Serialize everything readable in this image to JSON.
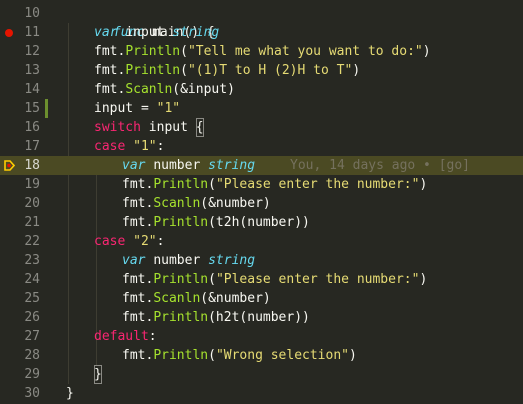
{
  "editor": {
    "lines": [
      {
        "num": "10"
      },
      {
        "num": "11"
      },
      {
        "num": "12"
      },
      {
        "num": "13"
      },
      {
        "num": "14"
      },
      {
        "num": "15"
      },
      {
        "num": "16"
      },
      {
        "num": "17"
      },
      {
        "num": "18"
      },
      {
        "num": "19"
      },
      {
        "num": "20"
      },
      {
        "num": "21"
      },
      {
        "num": "22"
      },
      {
        "num": "23"
      },
      {
        "num": "24"
      },
      {
        "num": "25"
      },
      {
        "num": "26"
      },
      {
        "num": "27"
      },
      {
        "num": "28"
      },
      {
        "num": "29"
      },
      {
        "num": "30"
      }
    ],
    "code": {
      "l10": {
        "kw": "func",
        "rest": " main() {"
      },
      "l11": {
        "kw": "var",
        "name": "input",
        "type": "string"
      },
      "l12": {
        "obj": "fmt.",
        "fn": "Println",
        "open": "(",
        "str": "\"Tell me what you want to do:\"",
        "close": ")"
      },
      "l13": {
        "obj": "fmt.",
        "fn": "Println",
        "open": "(",
        "str": "\"(1)T to H (2)H to T\"",
        "close": ")"
      },
      "l14": {
        "obj": "fmt.",
        "fn": "Scanln",
        "args": "(&input)"
      },
      "l15": {
        "lhs": "input = ",
        "str": "\"1\""
      },
      "l16": {
        "kw": "switch",
        "rest": " input ",
        "brace": "{"
      },
      "l17": {
        "kw": "case",
        "str": "\"1\"",
        "colon": ":"
      },
      "l18": {
        "kw": "var",
        "name": "number",
        "type": "string",
        "blame": "You, 14 days ago • [go]"
      },
      "l19": {
        "obj": "fmt.",
        "fn": "Println",
        "open": "(",
        "str": "\"Please enter the number:\"",
        "close": ")"
      },
      "l20": {
        "obj": "fmt.",
        "fn": "Scanln",
        "args": "(&number)"
      },
      "l21": {
        "obj": "fmt.",
        "fn": "Println",
        "args": "(t2h(number))"
      },
      "l22": {
        "kw": "case",
        "str": "\"2\"",
        "colon": ":"
      },
      "l23": {
        "kw": "var",
        "name": "number",
        "type": "string"
      },
      "l24": {
        "obj": "fmt.",
        "fn": "Println",
        "open": "(",
        "str": "\"Please enter the number:\"",
        "close": ")"
      },
      "l25": {
        "obj": "fmt.",
        "fn": "Scanln",
        "args": "(&number)"
      },
      "l26": {
        "obj": "fmt.",
        "fn": "Println",
        "args": "(h2t(number))"
      },
      "l27": {
        "kw": "default",
        "colon": ":"
      },
      "l28": {
        "obj": "fmt.",
        "fn": "Println",
        "open": "(",
        "str": "\"Wrong selection\"",
        "close": ")"
      },
      "l29": {
        "brace": "}"
      },
      "l30": {
        "brace": "}"
      }
    }
  },
  "colors": {
    "background": "#272822",
    "active_line": "#4b4a23",
    "keyword": "#66d9ef",
    "control_keyword": "#f92672",
    "function": "#a6e22e",
    "string": "#e6db74",
    "breakpoint": "#e51400",
    "modified_marker": "#6c8f2e"
  },
  "icons": {
    "breakpoint": "breakpoint-dot-icon",
    "debug_pointer": "debug-current-line-icon"
  }
}
